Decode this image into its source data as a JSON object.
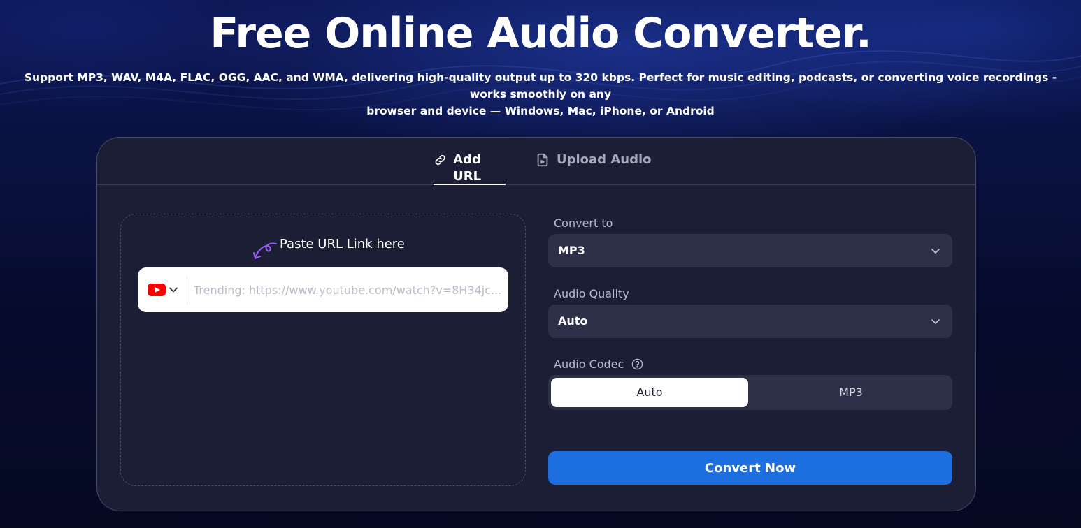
{
  "hero": {
    "title": "Free Online Audio Converter.",
    "subtitle_line1": "Support MP3, WAV, M4A, FLAC, OGG, AAC, and WMA, delivering high-quality output up to 320 kbps. Perfect for music editing, podcasts, or converting voice recordings - works smoothly on any",
    "subtitle_line2": "browser and device — Windows, Mac, iPhone, or Android"
  },
  "tabs": {
    "add_url": "Add URL",
    "upload_audio": "Upload Audio",
    "active": "add_url"
  },
  "url_panel": {
    "hint": "Paste URL Link here",
    "source": "youtube",
    "placeholder": "Trending: https://www.youtube.com/watch?v=8H34jc...",
    "value": ""
  },
  "settings": {
    "convert_to_label": "Convert to",
    "convert_to_value": "MP3",
    "quality_label": "Audio Quality",
    "quality_value": "Auto",
    "codec_label": "Audio Codec",
    "codec_options": [
      "Auto",
      "MP3"
    ],
    "codec_selected": "Auto"
  },
  "actions": {
    "convert_label": "Convert Now"
  },
  "icons": {
    "tab_url": "link-icon",
    "tab_upload": "file-audio-icon",
    "source": "youtube-icon",
    "dropdown": "chevron-down-icon",
    "help": "help-circle-icon",
    "hint_arrow": "curly-arrow-icon"
  },
  "colors": {
    "accent": "#1d6fe0",
    "card_bg": "#1b1e35",
    "field_bg": "#2d3049",
    "youtube_red": "#ff0000",
    "hint_arrow": "#9b5cf6"
  }
}
